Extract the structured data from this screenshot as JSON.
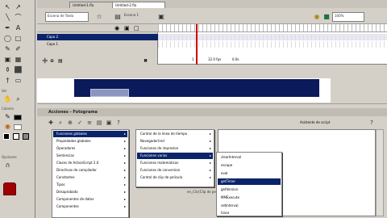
{
  "tabs": [
    "Untitled-1.fla",
    "Untitled-2.fla"
  ],
  "scene_field": "Escena de Texto",
  "scene_label": "Escena 1",
  "zoom_label": "100%",
  "timeline": {
    "layers": [
      {
        "name": "Capa 2",
        "selected": true
      },
      {
        "name": "Capa 1",
        "selected": false
      }
    ],
    "status": [
      "1",
      "12.0 fps",
      "0.0s"
    ]
  },
  "tools_section": "Ver",
  "colors_section": "Colores",
  "options_section": "Opciones",
  "actions": {
    "title": "Acciones - Fotograma",
    "ref_label": "Asistente de script",
    "script_line": "en_Clic(Clip de pelicula)"
  },
  "menu1": [
    {
      "label": "Funciones globales",
      "sel": true
    },
    {
      "label": "Propiedades globales"
    },
    {
      "label": "Operadores"
    },
    {
      "label": "Sentencias"
    },
    {
      "label": "Clases de ActionScript 2.0"
    },
    {
      "label": "Directivas de compilador"
    },
    {
      "label": "Constantes"
    },
    {
      "label": "Tipos"
    },
    {
      "label": "Desaprobado"
    },
    {
      "label": "Componentes de datos"
    },
    {
      "label": "Componentes"
    }
  ],
  "menu2": [
    {
      "label": "Control de la linea de tiempo"
    },
    {
      "label": "Navegador/red"
    },
    {
      "label": "Funciones de impresion"
    },
    {
      "label": "Funciones varias",
      "sel": true
    },
    {
      "label": "Funciones matematicas"
    },
    {
      "label": "Funciones de conversion"
    },
    {
      "label": "Control de clip de pelicula"
    }
  ],
  "menu3": [
    {
      "label": "clearInterval"
    },
    {
      "label": "escape"
    },
    {
      "label": "eval"
    },
    {
      "label": "getTimer",
      "sel": true
    },
    {
      "label": "getVersion"
    },
    {
      "label": "MMExecute"
    },
    {
      "label": "setInterval"
    },
    {
      "label": "trace"
    }
  ]
}
